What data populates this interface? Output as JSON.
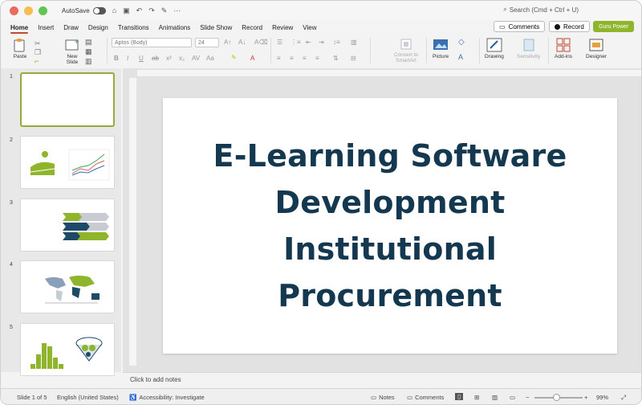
{
  "titlebar": {
    "autosave_label": "AutoSave",
    "search_placeholder": "Search (Cmd + Ctrl + U)"
  },
  "menu": {
    "tabs": [
      "Home",
      "Insert",
      "Draw",
      "Design",
      "Transitions",
      "Animations",
      "Slide Show",
      "Record",
      "Review",
      "View"
    ],
    "comments_label": "Comments",
    "record_label": "Record",
    "guru_label": "Guru Power"
  },
  "ribbon": {
    "paste_label": "Paste",
    "new_slide_label": "New Slide",
    "font_name": "Aptos (Body)",
    "font_size": "24",
    "convert_smartart_label": "Convert to SmartArt",
    "picture_label": "Picture",
    "drawing_label": "Drawing",
    "sensitivity_label": "Sensitivity",
    "addins_label": "Add-ins",
    "designer_label": "Designer"
  },
  "thumbnails": [
    "1",
    "2",
    "3",
    "4",
    "5"
  ],
  "slide": {
    "title_lines": [
      "E-Learning Software",
      "Development",
      "Institutional",
      "Procurement"
    ]
  },
  "notes_placeholder": "Click to add notes",
  "status": {
    "slide_counter": "Slide 1 of 5",
    "language": "English (United States)",
    "accessibility": "Accessibility: Investigate",
    "notes_label": "Notes",
    "comments_label": "Comments",
    "zoom_value": "99%"
  },
  "colors": {
    "accent": "#c2482f",
    "title_text": "#14384f",
    "guru_button": "#8fb52d",
    "selected_thumb_border": "#9aaa3a"
  }
}
